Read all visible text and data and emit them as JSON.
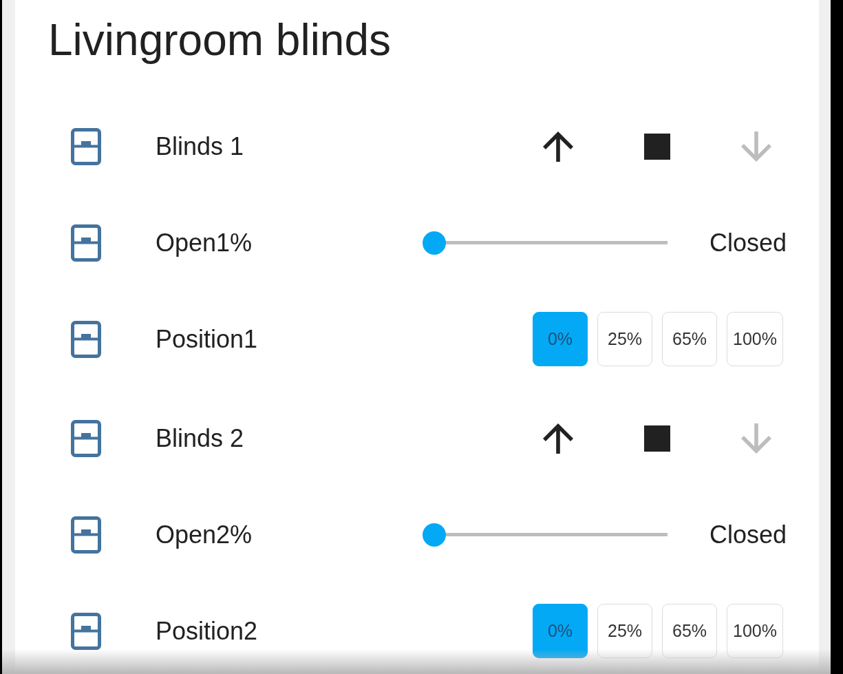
{
  "card": {
    "title": "Livingroom blinds",
    "rows": [
      {
        "kind": "cover",
        "name": "Blinds 1",
        "controls": [
          {
            "kind": "up",
            "disabled": false
          },
          {
            "kind": "stop",
            "disabled": false
          },
          {
            "kind": "down",
            "disabled": true
          }
        ]
      },
      {
        "kind": "slider",
        "name": "Open1%",
        "level": 0,
        "reading": "Closed"
      },
      {
        "kind": "select",
        "name": "Position1",
        "options": [
          {
            "label": "0%",
            "selected": true
          },
          {
            "label": "25%",
            "selected": false
          },
          {
            "label": "65%",
            "selected": false
          },
          {
            "label": "100%",
            "selected": false
          }
        ]
      },
      {
        "kind": "cover",
        "name": "Blinds 2",
        "controls": [
          {
            "kind": "up",
            "disabled": false
          },
          {
            "kind": "stop",
            "disabled": false
          },
          {
            "kind": "down",
            "disabled": true
          }
        ]
      },
      {
        "kind": "slider",
        "name": "Open2%",
        "level": 0,
        "reading": "Closed"
      },
      {
        "kind": "select",
        "name": "Position2",
        "options": [
          {
            "label": "0%",
            "selected": true
          },
          {
            "label": "25%",
            "selected": false
          },
          {
            "label": "65%",
            "selected": false
          },
          {
            "label": "100%",
            "selected": false
          }
        ]
      }
    ]
  }
}
